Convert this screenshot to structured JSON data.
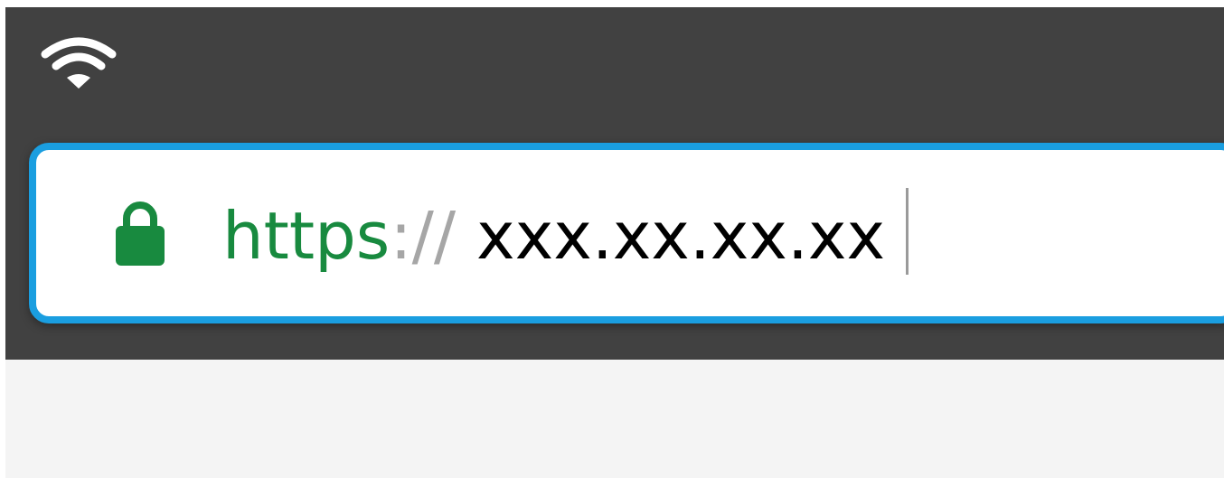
{
  "status_bar": {
    "wifi_icon": "wifi-icon"
  },
  "address_bar": {
    "secure_icon": "lock-icon",
    "scheme": "https",
    "separator": "://",
    "host": "xxx.xx.xx.xx",
    "caret_visible": true
  },
  "colors": {
    "toolbar_bg": "#414141",
    "focus_border": "#1a9ee0",
    "secure_green": "#188a3f",
    "separator_gray": "#a6a6a6",
    "page_bg": "#f4f4f4"
  }
}
